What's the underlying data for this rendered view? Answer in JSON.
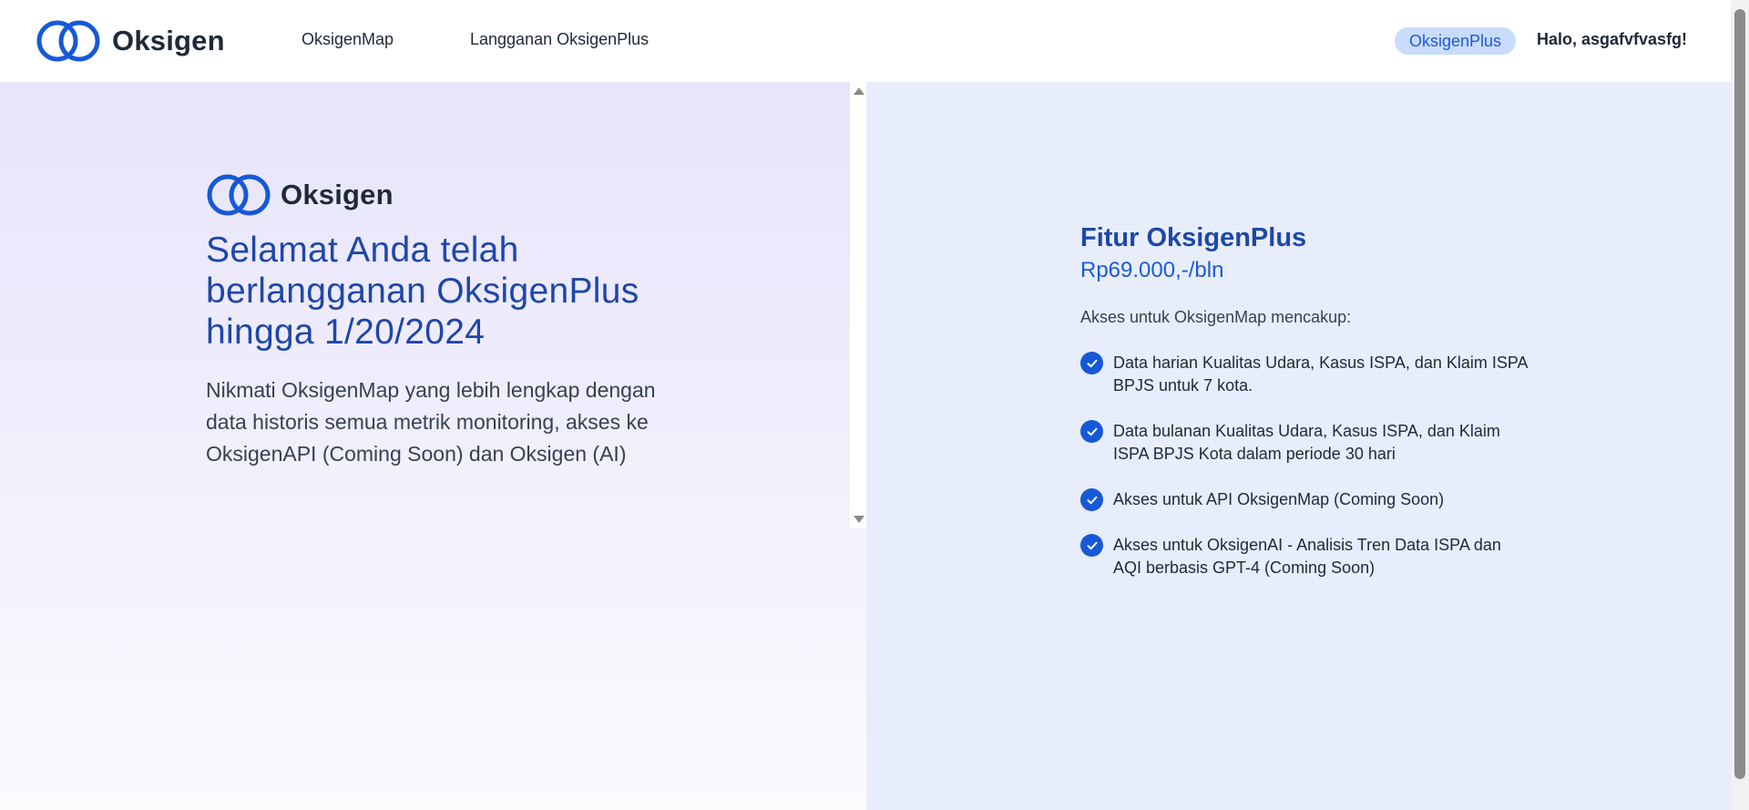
{
  "header": {
    "brand": "Oksigen",
    "nav": [
      {
        "label": "OksigenMap"
      },
      {
        "label": "Langganan OksigenPlus"
      }
    ],
    "plus_badge": "OksigenPlus",
    "greeting": "Halo, asgafvfvasfg!"
  },
  "left": {
    "brand": "Oksigen",
    "title": "Selamat Anda telah berlangganan OksigenPlus hingga 1/20/2024",
    "description": "Nikmati OksigenMap yang lebih lengkap dengan data historis semua metrik monitoring, akses ke OksigenAPI (Coming Soon) dan Oksigen (AI)"
  },
  "right": {
    "title": "Fitur OksigenPlus",
    "price": "Rp69.000,-/bln",
    "intro": "Akses untuk OksigenMap mencakup:",
    "features": [
      "Data harian Kualitas Udara, Kasus ISPA, dan Klaim ISPA BPJS untuk 7 kota.",
      "Data bulanan Kualitas Udara, Kasus ISPA, dan Klaim ISPA BPJS Kota dalam periode 30 hari",
      "Akses untuk API OksigenMap (Coming Soon)",
      "Akses untuk OksigenAI - Analisis Tren Data ISPA dan AQI berbasis GPT-4 (Coming Soon)"
    ]
  },
  "icons": {
    "logo": "double-ring-logo-icon",
    "check": "check-circle-icon"
  },
  "colors": {
    "brand_blue": "#1659d6",
    "title_blue": "#1e47a8",
    "badge_bg": "#c9dcfb",
    "right_bg": "#e7edfb"
  }
}
